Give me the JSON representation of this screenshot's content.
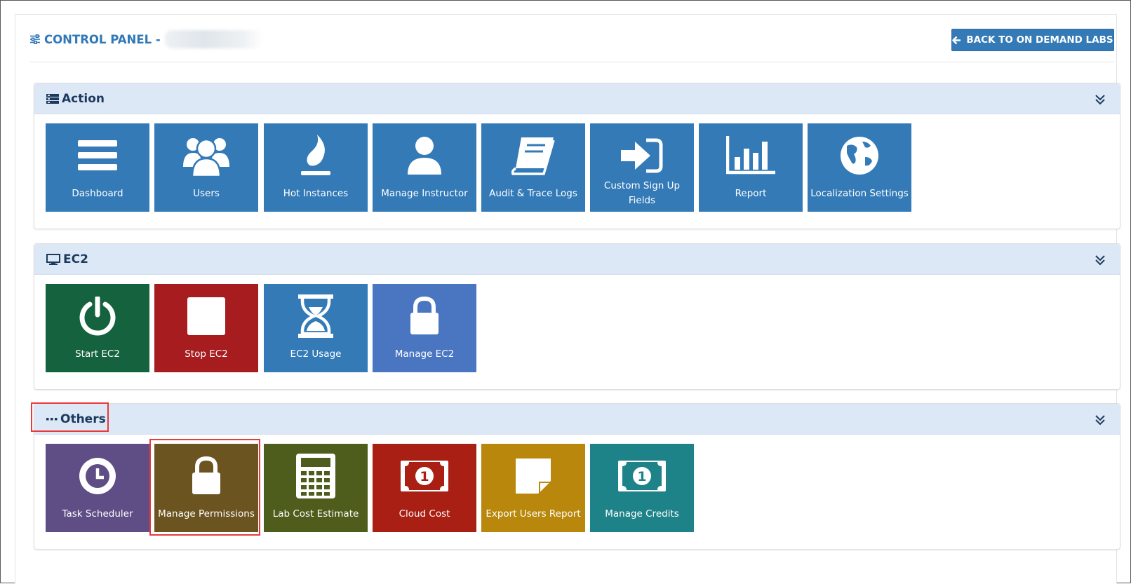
{
  "header": {
    "title": "CONTROL PANEL -",
    "back_button_label": "BACK TO ON DEMAND LABS"
  },
  "colors": {
    "accent": "#337ab7",
    "section_header_bg": "#dde8f6",
    "section_title": "#1c3a5e",
    "highlight": "#e8393c"
  },
  "sections": [
    {
      "title": "Action",
      "icon": "server-icon",
      "tiles": [
        {
          "label": "Dashboard",
          "icon": "bars-icon",
          "color": "#337ab7"
        },
        {
          "label": "Users",
          "icon": "users-icon",
          "color": "#337ab7"
        },
        {
          "label": "Hot Instances",
          "icon": "fire-icon",
          "color": "#337ab7"
        },
        {
          "label": "Manage Instructor",
          "icon": "user-icon",
          "color": "#337ab7"
        },
        {
          "label": "Audit & Trace Logs",
          "icon": "book-icon",
          "color": "#337ab7"
        },
        {
          "label": "Custom Sign Up Fields",
          "icon": "sign-in-icon",
          "color": "#337ab7"
        },
        {
          "label": "Report",
          "icon": "bar-chart-icon",
          "color": "#337ab7"
        },
        {
          "label": "Localization Settings",
          "icon": "globe-icon",
          "color": "#337ab7"
        }
      ]
    },
    {
      "title": "EC2",
      "icon": "desktop-icon",
      "tiles": [
        {
          "label": "Start EC2",
          "icon": "power-icon",
          "color": "#14623e"
        },
        {
          "label": "Stop EC2",
          "icon": "stop-icon",
          "color": "#a61c1f"
        },
        {
          "label": "EC2 Usage",
          "icon": "hourglass-icon",
          "color": "#337ab7"
        },
        {
          "label": "Manage EC2",
          "icon": "lock-icon",
          "color": "#4a76c1"
        }
      ]
    },
    {
      "title": "Others",
      "icon": "ellipsis-icon",
      "tiles": [
        {
          "label": "Task Scheduler",
          "icon": "clock-icon",
          "color": "#5e4e85"
        },
        {
          "label": "Manage Permissions",
          "icon": "lock-icon",
          "color": "#6b5420",
          "highlighted": true
        },
        {
          "label": "Lab Cost Estimate",
          "icon": "calculator-icon",
          "color": "#4e5c1c"
        },
        {
          "label": "Cloud Cost",
          "icon": "money-icon",
          "color": "#a91f14"
        },
        {
          "label": "Export Users Report",
          "icon": "sticky-note-icon",
          "color": "#b8870b"
        },
        {
          "label": "Manage Credits",
          "icon": "money-icon",
          "color": "#1e8289"
        }
      ]
    }
  ]
}
